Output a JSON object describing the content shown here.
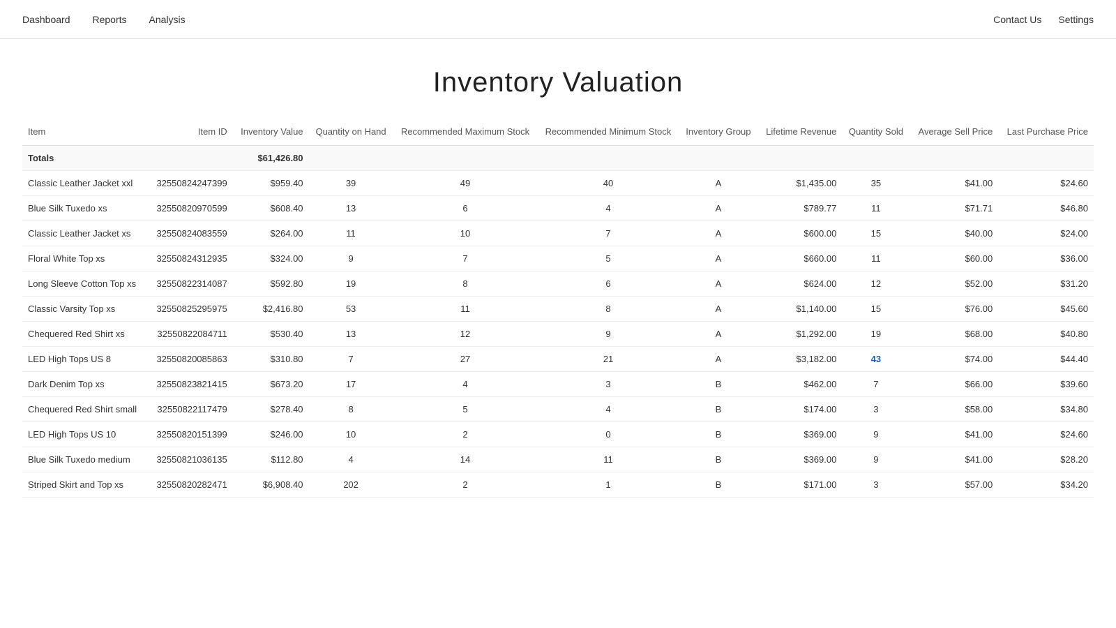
{
  "nav": {
    "left": [
      {
        "label": "Dashboard"
      },
      {
        "label": "Reports"
      },
      {
        "label": "Analysis"
      }
    ],
    "right": [
      {
        "label": "Contact Us"
      },
      {
        "label": "Settings"
      }
    ]
  },
  "page": {
    "title": "Inventory Valuation"
  },
  "table": {
    "columns": [
      {
        "key": "item",
        "label": "Item",
        "align": "left"
      },
      {
        "key": "itemId",
        "label": "Item ID",
        "align": "right"
      },
      {
        "key": "inventoryValue",
        "label": "Inventory Value",
        "align": "right"
      },
      {
        "key": "quantityOnHand",
        "label": "Quantity on Hand",
        "align": "center"
      },
      {
        "key": "recommendedMaxStock",
        "label": "Recommended Maximum Stock",
        "align": "center"
      },
      {
        "key": "recommendedMinStock",
        "label": "Recommended Minimum Stock",
        "align": "center"
      },
      {
        "key": "inventoryGroup",
        "label": "Inventory Group",
        "align": "center"
      },
      {
        "key": "lifetimeRevenue",
        "label": "Lifetime Revenue",
        "align": "right"
      },
      {
        "key": "quantitySold",
        "label": "Quantity Sold",
        "align": "center"
      },
      {
        "key": "averageSellPrice",
        "label": "Average Sell Price",
        "align": "right"
      },
      {
        "key": "lastPurchasePrice",
        "label": "Last Purchase Price",
        "align": "right"
      }
    ],
    "totals": {
      "label": "Totals",
      "inventoryValue": "$61,426.80"
    },
    "rows": [
      {
        "item": "Classic Leather Jacket xxl",
        "itemId": "32550824247399",
        "inventoryValue": "$959.40",
        "quantityOnHand": "39",
        "recommendedMaxStock": "49",
        "recommendedMinStock": "40",
        "inventoryGroup": "A",
        "lifetimeRevenue": "$1,435.00",
        "quantitySold": "35",
        "averageSellPrice": "$41.00",
        "lastPurchasePrice": "$24.60"
      },
      {
        "item": "Blue Silk Tuxedo xs",
        "itemId": "32550820970599",
        "inventoryValue": "$608.40",
        "quantityOnHand": "13",
        "recommendedMaxStock": "6",
        "recommendedMinStock": "4",
        "inventoryGroup": "A",
        "lifetimeRevenue": "$789.77",
        "quantitySold": "11",
        "averageSellPrice": "$71.71",
        "lastPurchasePrice": "$46.80"
      },
      {
        "item": "Classic Leather Jacket xs",
        "itemId": "32550824083559",
        "inventoryValue": "$264.00",
        "quantityOnHand": "11",
        "recommendedMaxStock": "10",
        "recommendedMinStock": "7",
        "inventoryGroup": "A",
        "lifetimeRevenue": "$600.00",
        "quantitySold": "15",
        "averageSellPrice": "$40.00",
        "lastPurchasePrice": "$24.00"
      },
      {
        "item": "Floral White Top xs",
        "itemId": "32550824312935",
        "inventoryValue": "$324.00",
        "quantityOnHand": "9",
        "recommendedMaxStock": "7",
        "recommendedMinStock": "5",
        "inventoryGroup": "A",
        "lifetimeRevenue": "$660.00",
        "quantitySold": "11",
        "averageSellPrice": "$60.00",
        "lastPurchasePrice": "$36.00"
      },
      {
        "item": "Long Sleeve Cotton Top xs",
        "itemId": "32550822314087",
        "inventoryValue": "$592.80",
        "quantityOnHand": "19",
        "recommendedMaxStock": "8",
        "recommendedMinStock": "6",
        "inventoryGroup": "A",
        "lifetimeRevenue": "$624.00",
        "quantitySold": "12",
        "averageSellPrice": "$52.00",
        "lastPurchasePrice": "$31.20"
      },
      {
        "item": "Classic Varsity Top xs",
        "itemId": "32550825295975",
        "inventoryValue": "$2,416.80",
        "quantityOnHand": "53",
        "recommendedMaxStock": "11",
        "recommendedMinStock": "8",
        "inventoryGroup": "A",
        "lifetimeRevenue": "$1,140.00",
        "quantitySold": "15",
        "averageSellPrice": "$76.00",
        "lastPurchasePrice": "$45.60"
      },
      {
        "item": "Chequered Red Shirt xs",
        "itemId": "32550822084711",
        "inventoryValue": "$530.40",
        "quantityOnHand": "13",
        "recommendedMaxStock": "12",
        "recommendedMinStock": "9",
        "inventoryGroup": "A",
        "lifetimeRevenue": "$1,292.00",
        "quantitySold": "19",
        "averageSellPrice": "$68.00",
        "lastPurchasePrice": "$40.80"
      },
      {
        "item": "LED High Tops US 8",
        "itemId": "32550820085863",
        "inventoryValue": "$310.80",
        "quantityOnHand": "7",
        "recommendedMaxStock": "27",
        "recommendedMinStock": "21",
        "inventoryGroup": "A",
        "lifetimeRevenue": "$3,182.00",
        "quantitySold": "43",
        "averageSellPrice": "$74.00",
        "lastPurchasePrice": "$44.40",
        "highlight": "quantitySold"
      },
      {
        "item": "Dark Denim Top xs",
        "itemId": "32550823821415",
        "inventoryValue": "$673.20",
        "quantityOnHand": "17",
        "recommendedMaxStock": "4",
        "recommendedMinStock": "3",
        "inventoryGroup": "B",
        "lifetimeRevenue": "$462.00",
        "quantitySold": "7",
        "averageSellPrice": "$66.00",
        "lastPurchasePrice": "$39.60"
      },
      {
        "item": "Chequered Red Shirt small",
        "itemId": "32550822117479",
        "inventoryValue": "$278.40",
        "quantityOnHand": "8",
        "recommendedMaxStock": "5",
        "recommendedMinStock": "4",
        "inventoryGroup": "B",
        "lifetimeRevenue": "$174.00",
        "quantitySold": "3",
        "averageSellPrice": "$58.00",
        "lastPurchasePrice": "$34.80"
      },
      {
        "item": "LED High Tops US 10",
        "itemId": "32550820151399",
        "inventoryValue": "$246.00",
        "quantityOnHand": "10",
        "recommendedMaxStock": "2",
        "recommendedMinStock": "0",
        "inventoryGroup": "B",
        "lifetimeRevenue": "$369.00",
        "quantitySold": "9",
        "averageSellPrice": "$41.00",
        "lastPurchasePrice": "$24.60"
      },
      {
        "item": "Blue Silk Tuxedo medium",
        "itemId": "32550821036135",
        "inventoryValue": "$112.80",
        "quantityOnHand": "4",
        "recommendedMaxStock": "14",
        "recommendedMinStock": "11",
        "inventoryGroup": "B",
        "lifetimeRevenue": "$369.00",
        "quantitySold": "9",
        "averageSellPrice": "$41.00",
        "lastPurchasePrice": "$28.20"
      },
      {
        "item": "Striped Skirt and Top xs",
        "itemId": "32550820282471",
        "inventoryValue": "$6,908.40",
        "quantityOnHand": "202",
        "recommendedMaxStock": "2",
        "recommendedMinStock": "1",
        "inventoryGroup": "B",
        "lifetimeRevenue": "$171.00",
        "quantitySold": "3",
        "averageSellPrice": "$57.00",
        "lastPurchasePrice": "$34.20"
      }
    ]
  }
}
